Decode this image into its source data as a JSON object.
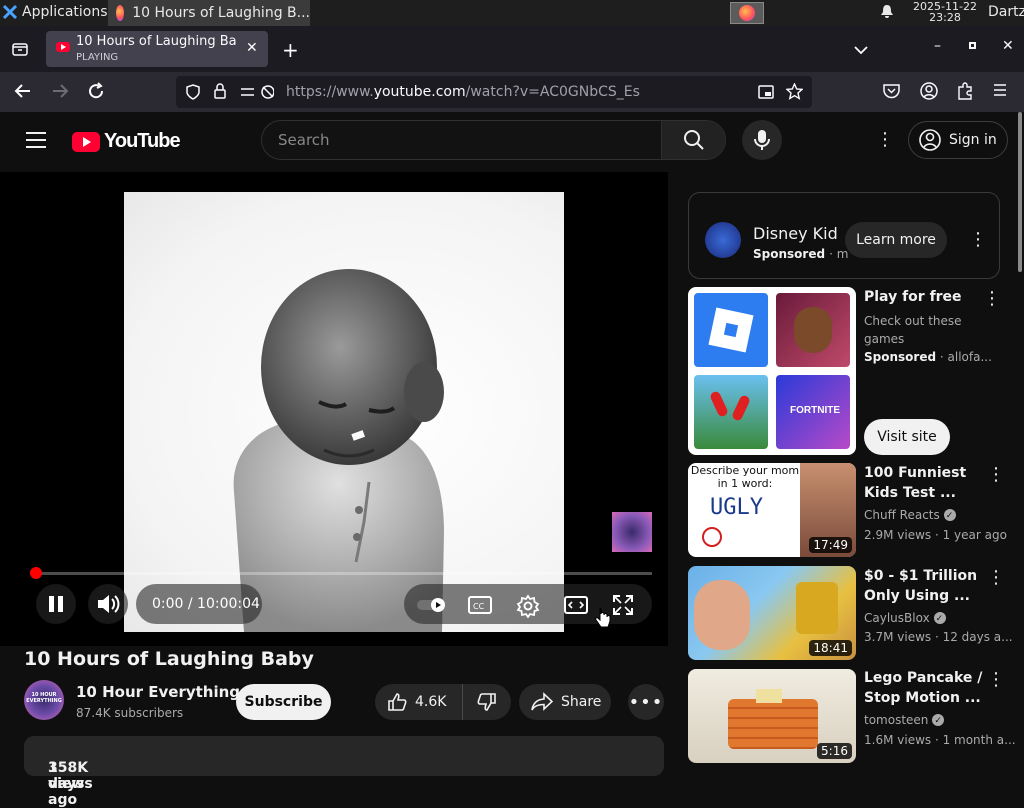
{
  "taskbar": {
    "applications_label": "Applications",
    "task_title": "10 Hours of Laughing B...",
    "date": "2025-11-22",
    "time": "23:28",
    "user": "Dartz"
  },
  "browser": {
    "tab_title": "10 Hours of Laughing Ba",
    "tab_status": "PLAYING",
    "url_prefix": "https://www.",
    "url_domain": "youtube.com",
    "url_path": "/watch?v=AC0GNbCS_Es"
  },
  "youtube": {
    "logo_text": "YouTube",
    "search_placeholder": "Search",
    "signin_label": "Sign in"
  },
  "player": {
    "time_display": "0:00 / 10:00:04",
    "progress": 0.0
  },
  "video": {
    "title": "10 Hours of Laughing Baby",
    "channel_name": "10 Hour Everything",
    "subscribers": "87.4K subscribers",
    "subscribe_label": "Subscribe",
    "likes": "4.6K",
    "share_label": "Share",
    "views": "158K views",
    "date": "3 days ago",
    "avatar_text": "10 HOUR EVERYTHING"
  },
  "sidebar": {
    "ad1": {
      "name": "Disney Kid",
      "sponsored": "Sponsored",
      "sponsor_suffix": "· m",
      "cta": "Learn more"
    },
    "ad2": {
      "title": "Play for free",
      "desc_line1": "Check out these",
      "desc_line2": "games",
      "sponsored": "Sponsored",
      "sponsor_suffix": "· allofa...",
      "cta": "Visit site"
    },
    "videos": [
      {
        "title_line1": "100 Funniest",
        "title_line2": "Kids Test ...",
        "channel": "Chuff Reacts",
        "meta": "2.9M views · 1 year ago",
        "duration": "17:49",
        "thumb_text1": "Describe your mom",
        "thumb_text2": "in 1 word:",
        "thumb_text3": "UGLY"
      },
      {
        "title_line1": "$0 - $1 Trillion",
        "title_line2": "Only Using ...",
        "channel": "CaylusBlox",
        "meta": "3.7M views · 12 days a...",
        "duration": "18:41"
      },
      {
        "title_line1": "Lego Pancake /",
        "title_line2": "Stop Motion ...",
        "channel": "tomosteen",
        "meta": "1.6M views · 1 month a...",
        "duration": "5:16"
      }
    ]
  },
  "colors": {
    "accent_red": "#ff0033",
    "background": "#0f0f0f",
    "pill": "#272727"
  }
}
